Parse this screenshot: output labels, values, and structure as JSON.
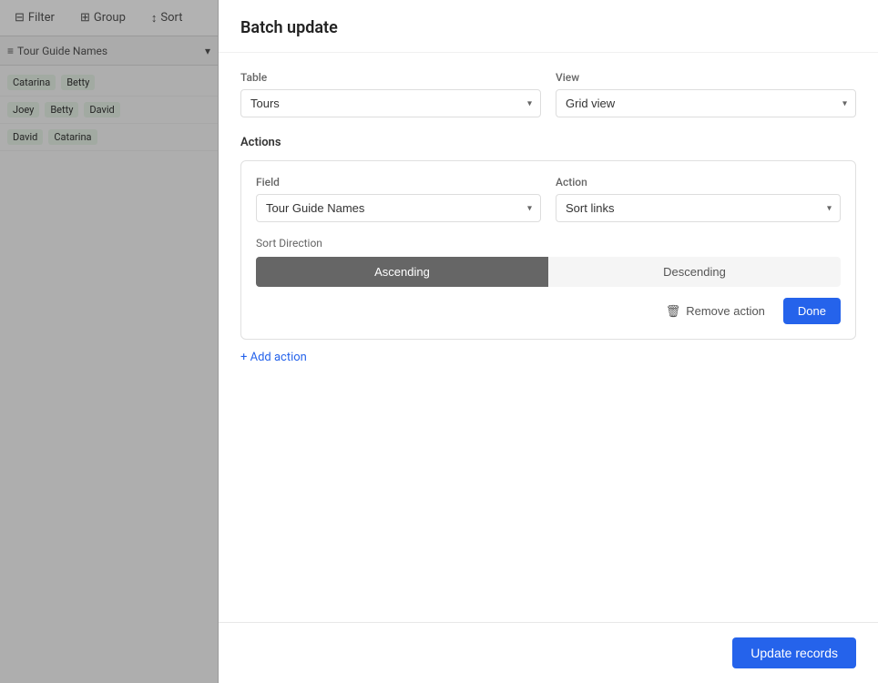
{
  "background": {
    "toolbar": {
      "filter_label": "Filter",
      "group_label": "Group",
      "sort_label": "Sort"
    },
    "table_header": {
      "column_label": "Tour Guide Names"
    },
    "rows": [
      {
        "tags": [
          "Catarina",
          "Betty"
        ]
      },
      {
        "tags": [
          "Joey",
          "Betty",
          "David"
        ]
      },
      {
        "tags": [
          "David",
          "Catarina"
        ]
      }
    ]
  },
  "modal": {
    "title": "Batch update",
    "table_label": "Table",
    "table_value": "Tours",
    "view_label": "View",
    "view_value": "Grid view",
    "actions_label": "Actions",
    "action_card": {
      "field_label": "Field",
      "field_value": "Tour Guide Names",
      "action_label": "Action",
      "action_value": "Sort links",
      "sort_direction_label": "Sort Direction",
      "ascending_label": "Ascending",
      "descending_label": "Descending",
      "remove_action_label": "Remove action",
      "done_label": "Done"
    },
    "add_action_label": "+ Add action",
    "update_records_label": "Update records"
  }
}
